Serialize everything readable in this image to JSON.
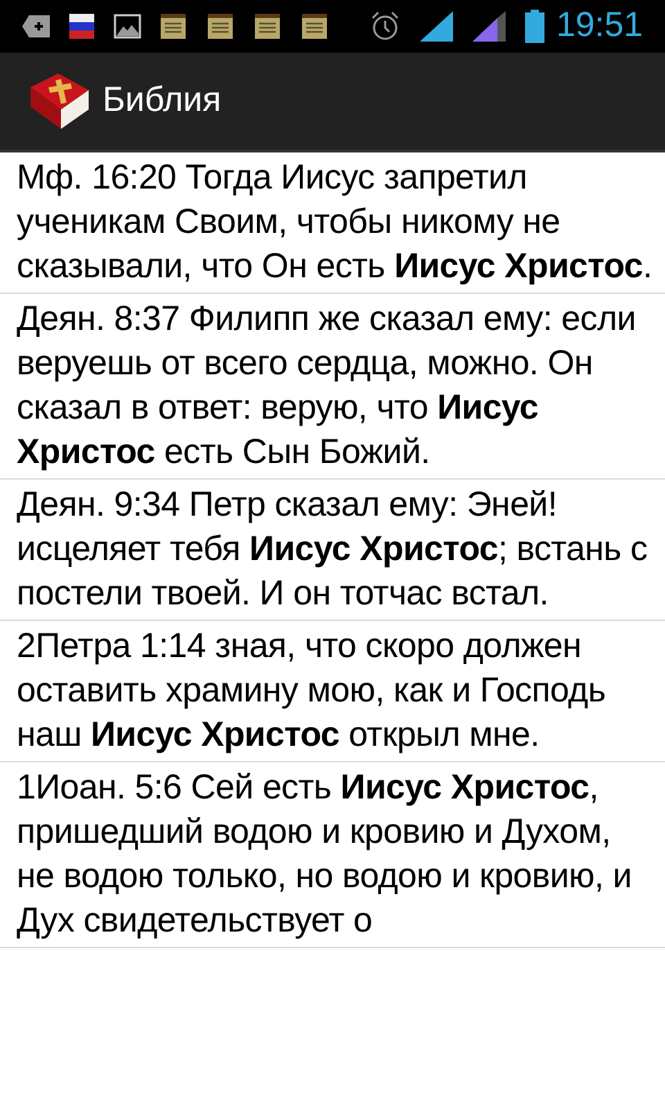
{
  "status_bar": {
    "time": "19:51"
  },
  "app_bar": {
    "title": "Библия"
  },
  "verses": [
    {
      "text": "Мф. 16:20 Тогда Иисус запретил ученикам Своим, чтобы никому не сказывали, что Он есть **Иисус Христос**."
    },
    {
      "text": "Деян. 8:37 Филипп же сказал ему: если веруешь от всего сердца, можно. Он сказал в ответ: верую, что **Иисус Христос** есть Сын Божий."
    },
    {
      "text": "Деян. 9:34 Петр сказал ему: Эней! исцеляет тебя **Иисус Христос**; встань с постели твоей. И он тотчас встал."
    },
    {
      "text": "2Петра 1:14 зная, что скоро должен оставить храмину мою, как и Господь наш **Иисус Христос** открыл мне."
    },
    {
      "text": "1Иоан. 5:6 Сей есть **Иисус Христос**, пришедший водою и кровию и Духом, не водою только, но водою и кровию, и Дух свидетельствует о"
    }
  ]
}
